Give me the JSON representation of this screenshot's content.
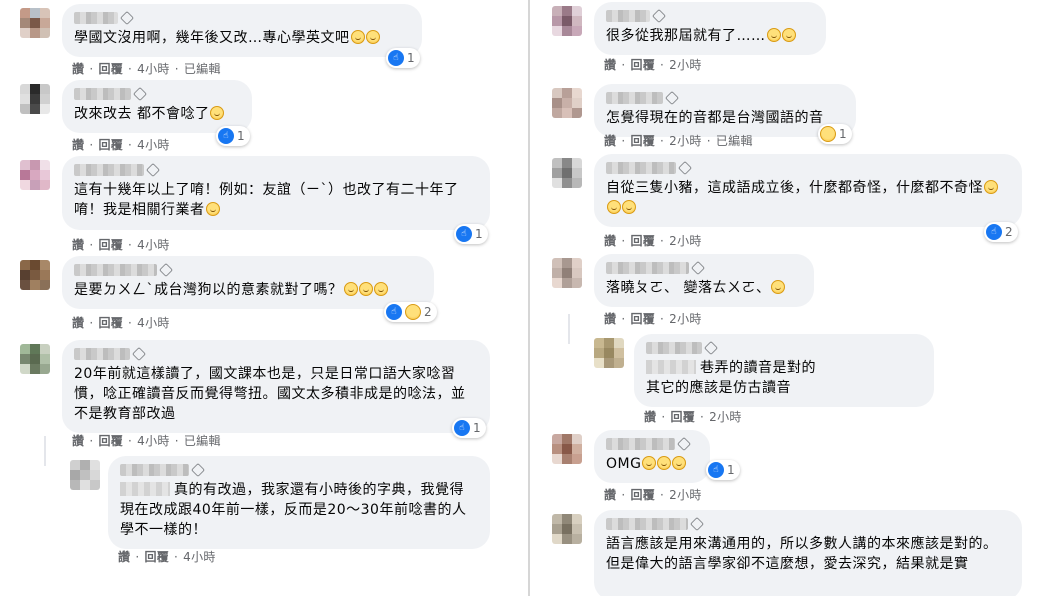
{
  "meta_labels": {
    "like": "讚",
    "reply": "回覆",
    "edited": "已編輯"
  },
  "left": [
    {
      "text": "學國文沒用啊，幾年後又改…專心學英文吧",
      "emojis": 2,
      "time": "4小時",
      "edited": true,
      "reactions": {
        "icons": [
          "like"
        ],
        "count": "1"
      }
    },
    {
      "text": "改來改去 都不會唸了",
      "emojis": 1,
      "time": "4小時",
      "edited": false,
      "reactions": {
        "icons": [
          "like"
        ],
        "count": "1"
      }
    },
    {
      "text": "這有十幾年以上了唷！例如：友誼（ㄧˋ）也改了有二十年了唷！我是相關行業者",
      "emojis": 1,
      "time": "4小時",
      "edited": false,
      "reactions": {
        "icons": [
          "like"
        ],
        "count": "1"
      }
    },
    {
      "text": "是要ㄉㄨㄥˋ成台灣狗以的意素就對了嗎？",
      "emojis": 3,
      "time": "4小時",
      "edited": false,
      "reactions": {
        "icons": [
          "like",
          "haha"
        ],
        "count": "2"
      }
    },
    {
      "text": "20年前就這樣讀了，國文課本也是，只是日常口語大家唸習慣，唸正確讀音反而覺得彆扭。國文太多積非成是的唸法，並不是教育部改過",
      "emojis": 0,
      "time": "4小時",
      "edited": true,
      "reactions": {
        "icons": [
          "like"
        ],
        "count": "1"
      }
    },
    {
      "text": "真的有改過，我家還有小時後的字典，我覺得現在改成跟40年前一樣，反而是20～30年前唸書的人學不一樣的！",
      "emojis": 0,
      "time": "4小時",
      "edited": false,
      "reply": true,
      "inline_blur": true
    }
  ],
  "right": [
    {
      "text": "很多從我那屆就有了……",
      "emojis": 2,
      "time": "2小時",
      "edited": false
    },
    {
      "text": "怎覺得現在的音都是台灣國語的音",
      "emojis": 0,
      "time": "2小時",
      "edited": true,
      "reactions": {
        "icons": [
          "haha"
        ],
        "count": "1"
      }
    },
    {
      "text": "自從三隻小豬，這成語成立後，什麼都奇怪，什麼都不奇怪",
      "emojis": 3,
      "time": "2小時",
      "edited": false,
      "reactions": {
        "icons": [
          "like"
        ],
        "count": "2"
      }
    },
    {
      "text": "落曉ㄆㄛ、 變落ㄊㄨㄛ、",
      "emojis": 1,
      "time": "2小時",
      "edited": false
    },
    {
      "text": "巷弄的讀音是對的\n其它的應該是仿古讀音",
      "emojis": 0,
      "time": "2小時",
      "edited": false,
      "reply": true,
      "inline_blur": true
    },
    {
      "text": "OMG",
      "emojis": 3,
      "time": "2小時",
      "edited": false,
      "reactions": {
        "icons": [
          "like"
        ],
        "count": "1"
      }
    },
    {
      "text": "語言應該是用來溝通用的，所以多數人講的本來應該是對的。\n但是偉大的語言學家卻不這麼想，愛去深究，結果就是實",
      "emojis": 0,
      "time": "",
      "edited": false
    }
  ]
}
